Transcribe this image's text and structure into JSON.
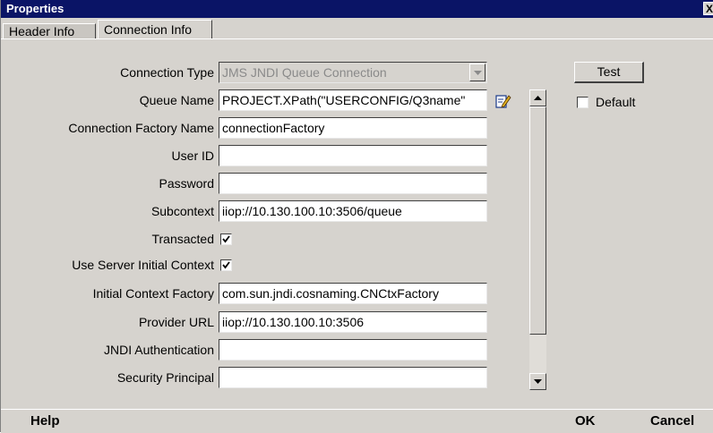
{
  "window": {
    "title": "Properties",
    "close_glyph": "X"
  },
  "tabs": [
    {
      "label": "Header Info",
      "active": false
    },
    {
      "label": "Connection Info",
      "active": true
    }
  ],
  "form": {
    "connection_type": {
      "label": "Connection Type",
      "value": "JMS JNDI Queue Connection",
      "enabled": false
    },
    "queue_name": {
      "label": "Queue Name",
      "value": "PROJECT.XPath(\"USERCONFIG/Q3name\""
    },
    "connection_factory_name": {
      "label": "Connection Factory Name",
      "value": "connectionFactory"
    },
    "user_id": {
      "label": "User ID",
      "value": ""
    },
    "password": {
      "label": "Password",
      "value": ""
    },
    "subcontext": {
      "label": "Subcontext",
      "value": "iiop://10.130.100.10:3506/queue"
    },
    "transacted": {
      "label": "Transacted",
      "checked": true
    },
    "use_server_initial_context": {
      "label": "Use Server Initial Context",
      "checked": true
    },
    "initial_context_factory": {
      "label": "Initial Context Factory",
      "value": "com.sun.jndi.cosnaming.CNCtxFactory"
    },
    "provider_url": {
      "label": "Provider URL",
      "value": "iiop://10.130.100.10:3506"
    },
    "jndi_authentication": {
      "label": "JNDI Authentication",
      "value": ""
    },
    "security_principal": {
      "label": "Security Principal",
      "value": ""
    }
  },
  "side": {
    "test_label": "Test",
    "default_label": "Default",
    "default_checked": false
  },
  "bottom": {
    "help": "Help",
    "ok": "OK",
    "cancel": "Cancel"
  },
  "icons": {
    "edit": "edit-pencil-icon",
    "dropdown": "chevron-down-icon"
  },
  "colors": {
    "titlebar": "#0a1466",
    "chrome": "#d6d3ce",
    "field": "#ffffff"
  }
}
